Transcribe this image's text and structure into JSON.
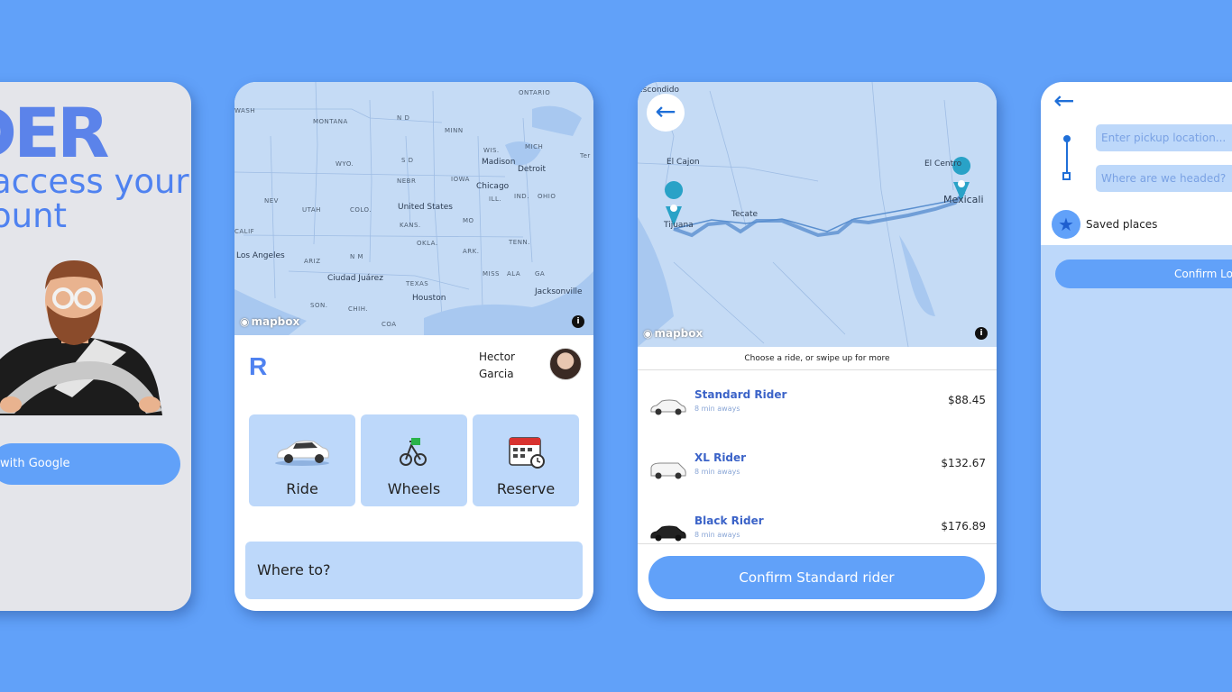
{
  "screen1": {
    "logo": "DER",
    "title": "access your\nount",
    "google_button": "with Google"
  },
  "screen2": {
    "map": {
      "regions": [
        "WASH",
        "MONTANA",
        "N D",
        "MINN",
        "ONTARIO",
        "WYO.",
        "S D",
        "WIS.",
        "MICH",
        "NEV",
        "UTAH",
        "COLO.",
        "NEBR",
        "IOWA",
        "KANS.",
        "MO",
        "ILL.",
        "IND.",
        "OHIO",
        "CALIF",
        "OKLA.",
        "ARK.",
        "TENN.",
        "ARIZ",
        "N M",
        "MISS",
        "ALA",
        "GA",
        "TEXAS",
        "SON.",
        "CHIH.",
        "COA",
        "Ter"
      ],
      "cities": [
        "Madison",
        "Detroit",
        "Chicago",
        "United States",
        "Los Angeles",
        "Ciudad Juárez",
        "Houston",
        "Jacksonville"
      ],
      "attribution": "mapbox",
      "info": "i"
    },
    "logo_letter": "R",
    "user_first": "Hector",
    "user_last": "Garcia",
    "tiles": [
      {
        "label": "Ride",
        "icon": "car-icon"
      },
      {
        "label": "Wheels",
        "icon": "scooter-icon"
      },
      {
        "label": "Reserve",
        "icon": "calendar-icon"
      }
    ],
    "where_to": "Where to?"
  },
  "screen3": {
    "map": {
      "labels": [
        "Escondido",
        "El Cajon",
        "Tecate",
        "El Centro",
        "Mexicali",
        "Tijuana"
      ],
      "attribution": "mapbox",
      "info": "i"
    },
    "choose_text": "Choose a ride, or swipe up for more",
    "rides": [
      {
        "name": "Standard Rider",
        "eta": "8 min aways",
        "price": "$88.45",
        "car_color": "#ffffff"
      },
      {
        "name": "XL Rider",
        "eta": "8 min aways",
        "price": "$132.67",
        "car_color": "#ffffff"
      },
      {
        "name": "Black Rider",
        "eta": "8 min aways",
        "price": "$176.89",
        "car_color": "#222222"
      }
    ],
    "confirm": "Confirm Standard rider"
  },
  "screen4": {
    "pickup_placeholder": "Enter pickup location...",
    "destination_placeholder": "Where are we headed?",
    "saved_places": "Saved places",
    "confirm": "Confirm Lo"
  },
  "colors": {
    "background": "#61a1f9",
    "accent": "#4f82f0",
    "tile": "#bdd8fa",
    "map": "#c5dbf5"
  }
}
